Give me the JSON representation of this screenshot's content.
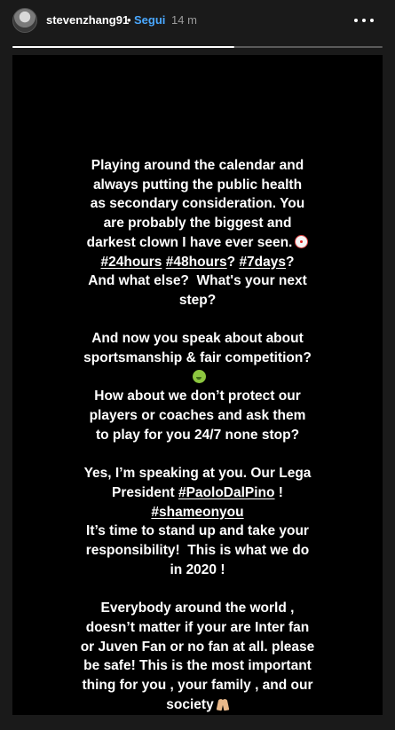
{
  "header": {
    "username": "stevenzhang91",
    "separator": "•",
    "follow_label": "Segui",
    "time_ago": "14 m",
    "more_icon": "more-horizontal-icon"
  },
  "progress": {
    "fraction": 0.6
  },
  "story": {
    "paragraphs": [
      [
        [
          {
            "t": "Playing around the calendar and"
          }
        ],
        [
          {
            "t": "always putting the public health"
          }
        ],
        [
          {
            "t": "as secondary consideration. You"
          }
        ],
        [
          {
            "t": "are probably the biggest and"
          }
        ],
        [
          {
            "t": "darkest clown I have ever seen."
          },
          {
            "emoji": "clown-emoji"
          }
        ],
        [
          {
            "t": "#24hours",
            "tag": true
          },
          {
            "t": " "
          },
          {
            "t": "#48hours",
            "tag": true
          },
          {
            "t": "? "
          },
          {
            "t": "#7days",
            "tag": true
          },
          {
            "t": "?"
          }
        ],
        [
          {
            "t": "And what else?  What's your next"
          }
        ],
        [
          {
            "t": "step?"
          }
        ]
      ],
      [
        [
          {
            "t": "And now you speak about about"
          }
        ],
        [
          {
            "t": "sportsmanship & fair competition?"
          }
        ],
        [
          {
            "emoji": "nauseated-face-emoji"
          }
        ],
        [
          {
            "t": "How about we don’t protect our"
          }
        ],
        [
          {
            "t": "players or coaches and ask them"
          }
        ],
        [
          {
            "t": "to play for you 24/7 none stop?"
          }
        ]
      ],
      [
        [
          {
            "t": "Yes, I’m speaking at you. Our Lega"
          }
        ],
        [
          {
            "t": "President "
          },
          {
            "t": "#PaoloDalPino",
            "tag": true
          },
          {
            "t": " !"
          }
        ],
        [
          {
            "t": "#shameonyou",
            "tag": true
          }
        ],
        [
          {
            "t": "It’s time to stand up and take your"
          }
        ],
        [
          {
            "t": "responsibility!  This is what we do"
          }
        ],
        [
          {
            "t": "in 2020 !"
          }
        ]
      ],
      [
        [
          {
            "t": "Everybody around the world ,"
          }
        ],
        [
          {
            "t": "doesn’t matter if your are Inter fan"
          }
        ],
        [
          {
            "t": "or Juven Fan or no fan at all. please"
          }
        ],
        [
          {
            "t": "be safe! This is the most important"
          }
        ],
        [
          {
            "t": "thing for you , your family , and our"
          }
        ],
        [
          {
            "t": "society"
          },
          {
            "emoji": "folded-hands-emoji"
          }
        ]
      ]
    ]
  }
}
